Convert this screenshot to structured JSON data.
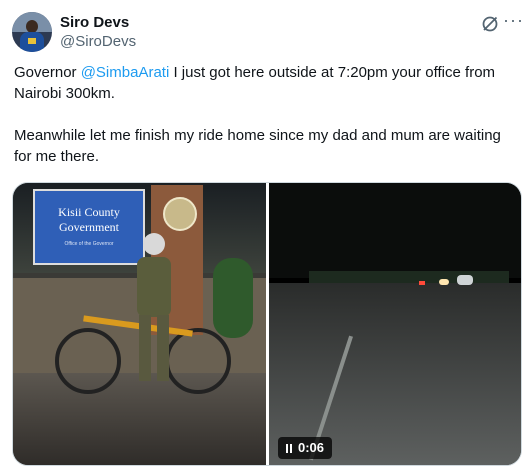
{
  "author": {
    "name": "Siro Devs",
    "handle": "@SiroDevs"
  },
  "tweet": {
    "p1_prefix": "Governor ",
    "p1_mention": "@SimbaArati",
    "p1_suffix": " I just got here outside at 7:20pm your office from Nairobi 300km.",
    "p2": "Meanwhile let me finish my ride home since my dad and mum are waiting for me there."
  },
  "media": {
    "photo_sign_line1": "Kisii County",
    "photo_sign_line2": "Government",
    "photo_sign_line3": "Office of the Governor",
    "video_time": "0:06"
  },
  "icons": {
    "grok": "grok-icon",
    "more": "more-icon",
    "pause": "pause-icon"
  },
  "colors": {
    "link": "#1d9bf0",
    "secondary": "#536471",
    "text": "#0f1419"
  }
}
